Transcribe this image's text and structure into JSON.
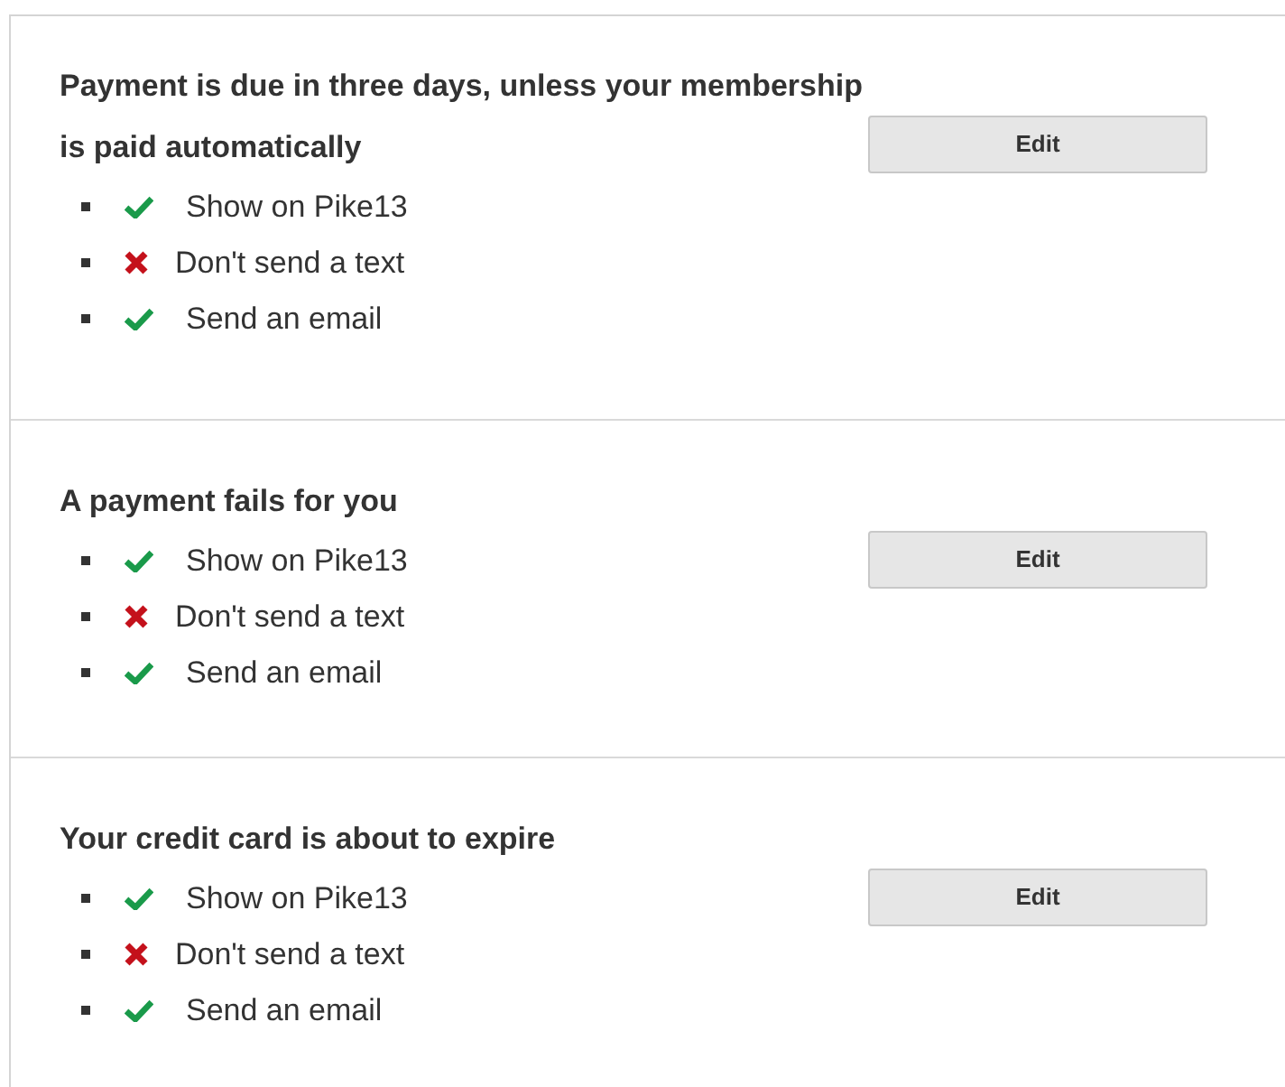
{
  "sections": [
    {
      "title": "Payment is due in three days, unless your membership is paid automatically",
      "button": "Edit",
      "items": [
        {
          "text": "Show on Pike13",
          "enabled": true
        },
        {
          "text": "Don't send a text",
          "enabled": false
        },
        {
          "text": "Send an email",
          "enabled": true
        }
      ]
    },
    {
      "title": "A payment fails for you",
      "button": "Edit",
      "items": [
        {
          "text": "Show on Pike13",
          "enabled": true
        },
        {
          "text": "Don't send a text",
          "enabled": false
        },
        {
          "text": "Send an email",
          "enabled": true
        }
      ]
    },
    {
      "title": "Your credit card is about to expire",
      "button": "Edit",
      "items": [
        {
          "text": "Show on Pike13",
          "enabled": true
        },
        {
          "text": "Don't send a text",
          "enabled": false
        },
        {
          "text": "Send an email",
          "enabled": true
        }
      ]
    }
  ]
}
